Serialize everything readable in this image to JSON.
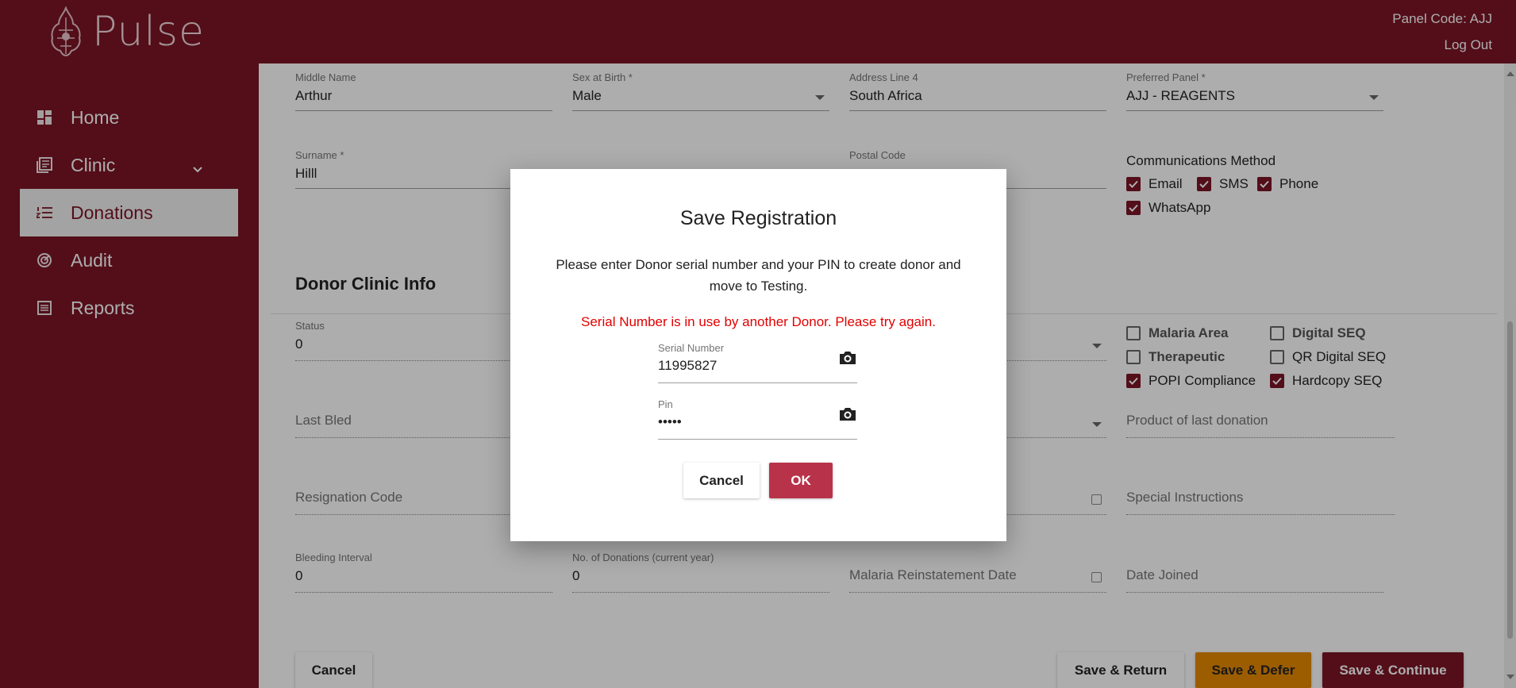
{
  "app": {
    "name": "Pulse"
  },
  "header": {
    "panel_code": "Panel Code: AJJ",
    "logout": "Log Out"
  },
  "sidebar": {
    "items": [
      {
        "label": "Home",
        "icon": "dashboard-icon"
      },
      {
        "label": "Clinic",
        "icon": "clinic-icon"
      },
      {
        "label": "Donations",
        "icon": "donations-list-icon"
      },
      {
        "label": "Audit",
        "icon": "audit-icon"
      },
      {
        "label": "Reports",
        "icon": "reports-icon"
      }
    ]
  },
  "form": {
    "middle_name": {
      "label": "Middle Name",
      "value": "Arthur"
    },
    "sex": {
      "label": "Sex at Birth *",
      "value": "Male"
    },
    "address4": {
      "label": "Address Line 4",
      "value": "South Africa"
    },
    "panel": {
      "label": "Preferred Panel *",
      "value": "AJJ - REAGENTS"
    },
    "surname": {
      "label": "Surname *",
      "value": "Hilll"
    },
    "postal": {
      "label": "Postal Code",
      "value": ""
    },
    "comms": {
      "title": "Communications Method",
      "options": [
        {
          "label": "Email",
          "checked": true
        },
        {
          "label": "SMS",
          "checked": true
        },
        {
          "label": "Phone",
          "checked": true
        },
        {
          "label": "WhatsApp",
          "checked": true
        }
      ]
    },
    "clinic_title": "Donor Clinic Info",
    "status": {
      "label": "Status",
      "value": "0"
    },
    "flags": [
      {
        "label": "Malaria Area",
        "checked": false
      },
      {
        "label": "Digital SEQ",
        "checked": false
      },
      {
        "label": "Therapeutic",
        "checked": false
      },
      {
        "label": "QR Digital SEQ",
        "checked": false
      },
      {
        "label": "POPI Compliance",
        "checked": true
      },
      {
        "label": "Hardcopy SEQ",
        "checked": true
      }
    ],
    "last_bled": "Last Bled",
    "product_last": "Product of last donation",
    "resignation": "Resignation Code",
    "special": "Special Instructions",
    "bleeding_interval": {
      "label": "Bleeding Interval",
      "value": "0"
    },
    "num_donations": {
      "label": "No. of Donations (current year)",
      "value": "0"
    },
    "malaria_reinst": "Malaria Reinstatement Date",
    "date_joined": "Date Joined"
  },
  "footer": {
    "cancel": "Cancel",
    "save_return": "Save & Return",
    "save_defer": "Save & Defer",
    "save_continue": "Save & Continue"
  },
  "dialog": {
    "title": "Save Registration",
    "message": "Please enter Donor serial number and your PIN to create donor and move to Testing.",
    "error": "Serial Number is in use by another Donor. Please try again.",
    "serial_label": "Serial Number",
    "serial_value": "11995827",
    "pin_label": "Pin",
    "pin_value": "•••••",
    "cancel": "Cancel",
    "ok": "OK"
  },
  "colors": {
    "brand": "#7b1525",
    "defer": "#e68a00",
    "ok": "#b8334a",
    "error": "#e30000"
  }
}
